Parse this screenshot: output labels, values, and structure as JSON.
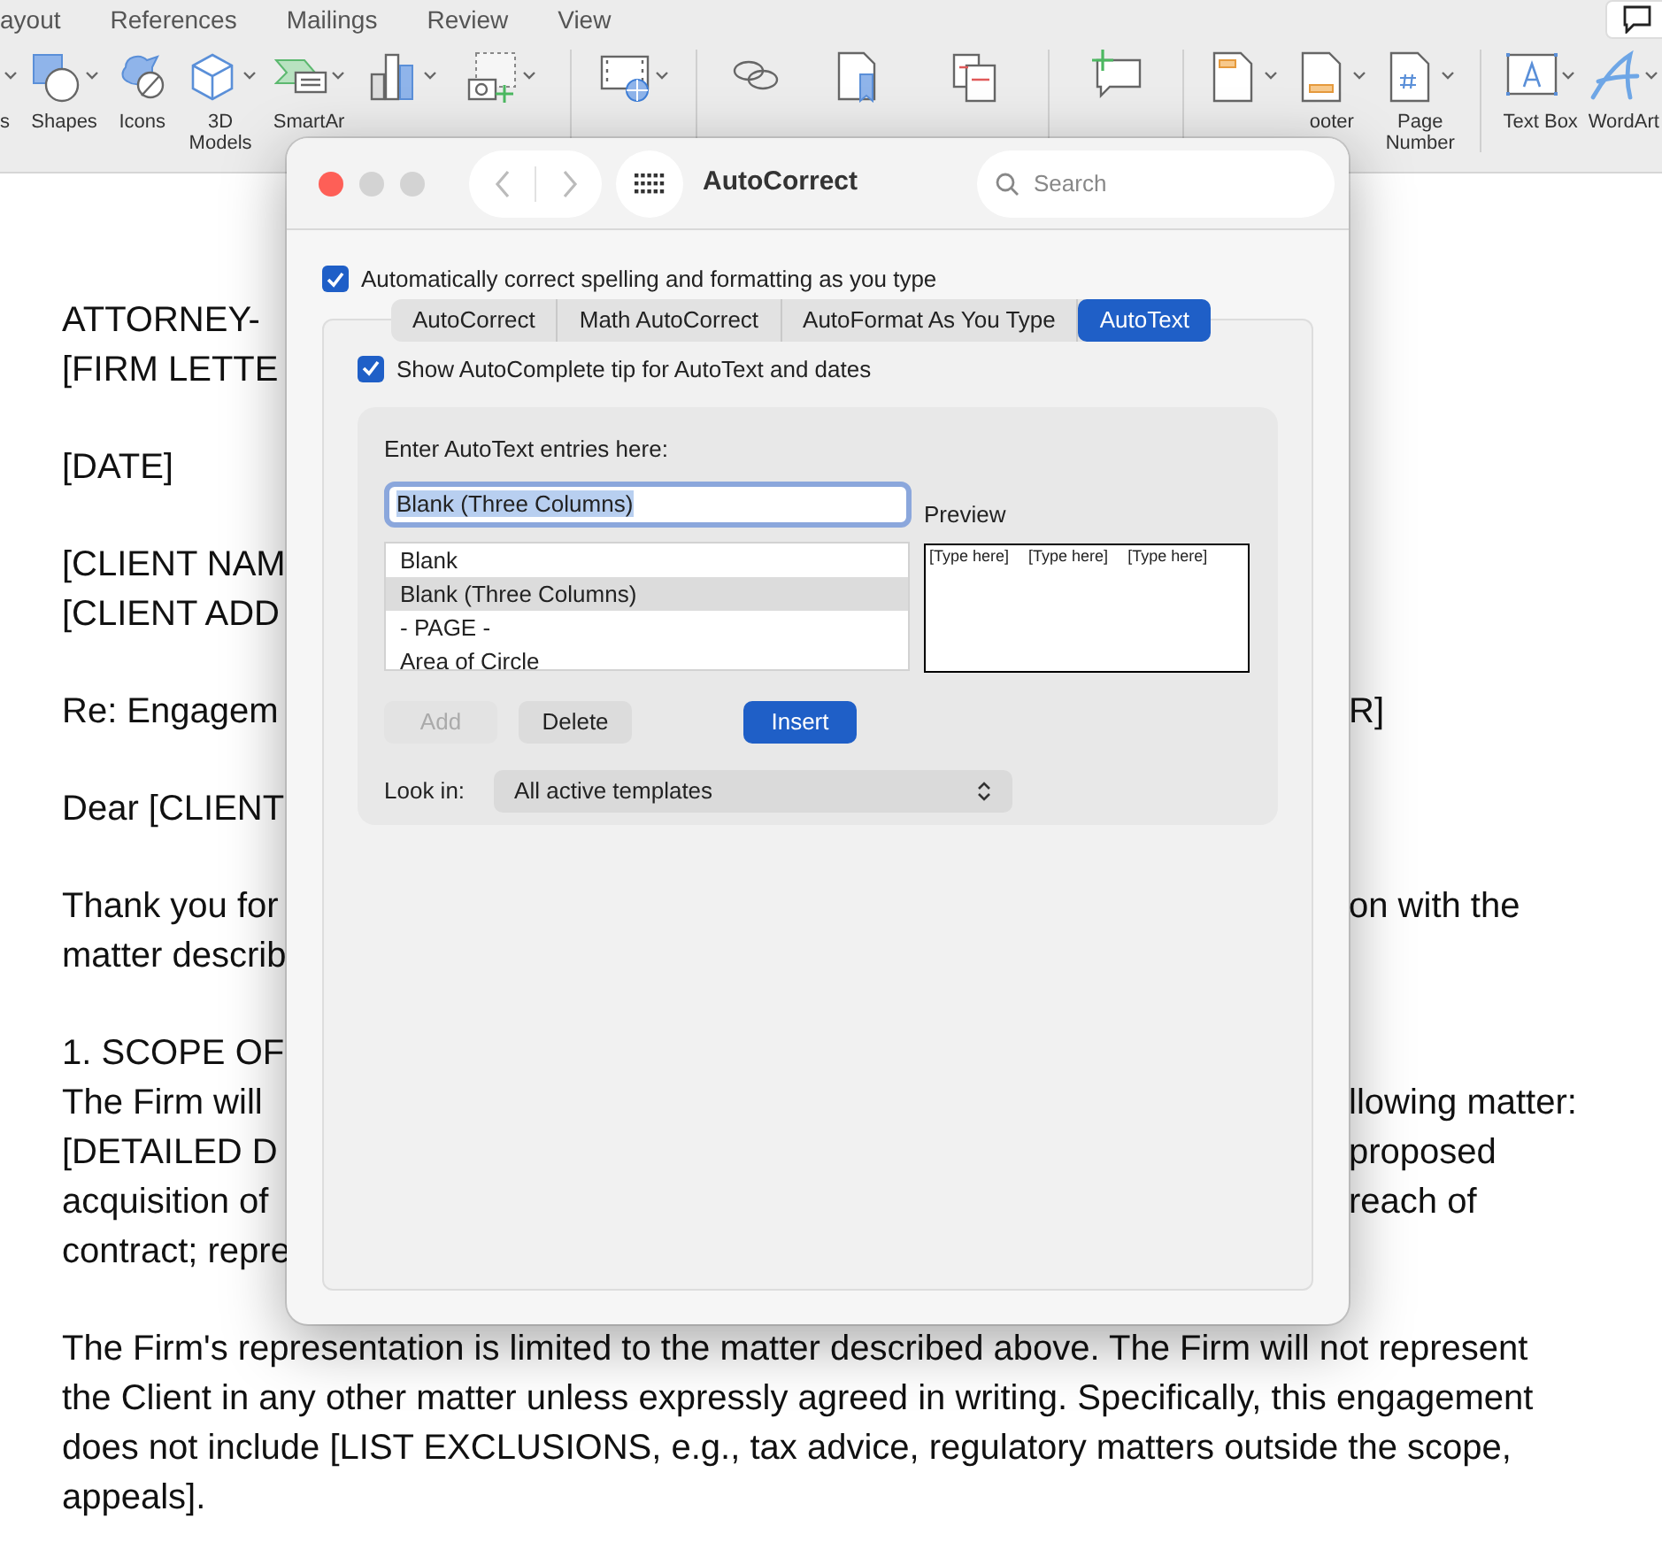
{
  "menu_tabs": [
    {
      "label": "ayout"
    },
    {
      "label": "References"
    },
    {
      "label": "Mailings"
    },
    {
      "label": "Review"
    },
    {
      "label": "View"
    }
  ],
  "ribbon": [
    {
      "kind": "cut",
      "label": "s",
      "menu": true
    },
    {
      "kind": "shapes",
      "label": "Shapes",
      "menu": true
    },
    {
      "kind": "icons",
      "label": "Icons",
      "menu": false
    },
    {
      "kind": "cube",
      "label": "3D Models",
      "menu": true
    },
    {
      "kind": "smartart",
      "label": "SmartAr",
      "menu": true
    },
    {
      "kind": "chart",
      "menu": true
    },
    {
      "kind": "screenshot",
      "menu": true
    },
    {
      "kind": "separator"
    },
    {
      "kind": "media",
      "menu": true
    },
    {
      "kind": "separator"
    },
    {
      "kind": "link",
      "menu": false
    },
    {
      "kind": "bookmark",
      "menu": false
    },
    {
      "kind": "crossref",
      "menu": false
    },
    {
      "kind": "separator"
    },
    {
      "kind": "comment",
      "menu": false
    },
    {
      "kind": "separator"
    },
    {
      "kind": "header",
      "menu": true
    },
    {
      "kind": "footer",
      "label": "ooter",
      "menu": true
    },
    {
      "kind": "pagenumber",
      "label": "Page Number",
      "menu": true
    },
    {
      "kind": "separator"
    },
    {
      "kind": "textbox",
      "label": "Text Box",
      "menu": true
    },
    {
      "kind": "wordart",
      "label": "WordArt",
      "menu": true
    }
  ],
  "document": {
    "paragraphs": [
      {
        "lines": [
          {
            "left": "ATTORNEY-"
          },
          {
            "left": "[FIRM LETTE"
          }
        ]
      },
      {
        "lines": [
          {
            "left": "[DATE]"
          }
        ]
      },
      {
        "lines": [
          {
            "left": "[CLIENT NAM"
          },
          {
            "left": "[CLIENT ADD"
          }
        ]
      },
      {
        "lines": [
          {
            "left": "Re: Engagem",
            "right": "R]"
          }
        ]
      },
      {
        "lines": [
          {
            "left": "Dear [CLIENT"
          }
        ]
      },
      {
        "lines": [
          {
            "left": "Thank you for",
            "right": "on with the"
          },
          {
            "left": "matter describ"
          }
        ]
      },
      {
        "lines": [
          {
            "left": "1. SCOPE OF"
          },
          {
            "left": "The Firm will",
            "right": "llowing matter:"
          },
          {
            "left": "[DETAILED D",
            "right": "proposed"
          },
          {
            "left": "acquisition of",
            "right": "reach of"
          },
          {
            "left": "contract; repre"
          }
        ]
      },
      {
        "lines": [
          {
            "left": "The Firm's representation is limited to the matter described above. The Firm will not represent"
          },
          {
            "left": "the Client in any other matter unless expressly agreed in writing. Specifically, this engagement"
          },
          {
            "left": "does not include [LIST EXCLUSIONS, e.g., tax advice, regulatory matters outside the scope,"
          },
          {
            "left": "appeals]."
          }
        ]
      }
    ]
  },
  "dialog": {
    "title": "AutoCorrect",
    "search": {
      "placeholder": "Search"
    },
    "auto_correct": {
      "label": "Automatically correct spelling and formatting as you type",
      "checked": true
    },
    "tabs": [
      {
        "label": "AutoCorrect",
        "selected": false
      },
      {
        "label": "Math AutoCorrect",
        "selected": false
      },
      {
        "label": "AutoFormat As You Type",
        "selected": false
      },
      {
        "label": "AutoText",
        "selected": true
      }
    ],
    "show_tip": {
      "label": "Show AutoComplete tip for AutoText and dates",
      "checked": true
    },
    "entries_label": "Enter AutoText entries here:",
    "entry_value": "Blank (Three Columns)",
    "entries": [
      {
        "label": "Blank",
        "selected": false
      },
      {
        "label": "Blank (Three Columns)",
        "selected": true
      },
      {
        "label": "- PAGE -",
        "selected": false
      },
      {
        "label": "Area of Circle",
        "selected": false
      }
    ],
    "preview_label": "Preview",
    "preview_cells": [
      "[Type here]",
      "[Type here]",
      "[Type here]"
    ],
    "buttons": [
      {
        "label": "Add",
        "kind": "plain",
        "disabled": true
      },
      {
        "label": "Delete",
        "kind": "plain",
        "disabled": false
      },
      {
        "label": "Insert",
        "kind": "default",
        "disabled": false
      }
    ],
    "look_in": {
      "label": "Look in:",
      "value": "All active templates"
    }
  }
}
